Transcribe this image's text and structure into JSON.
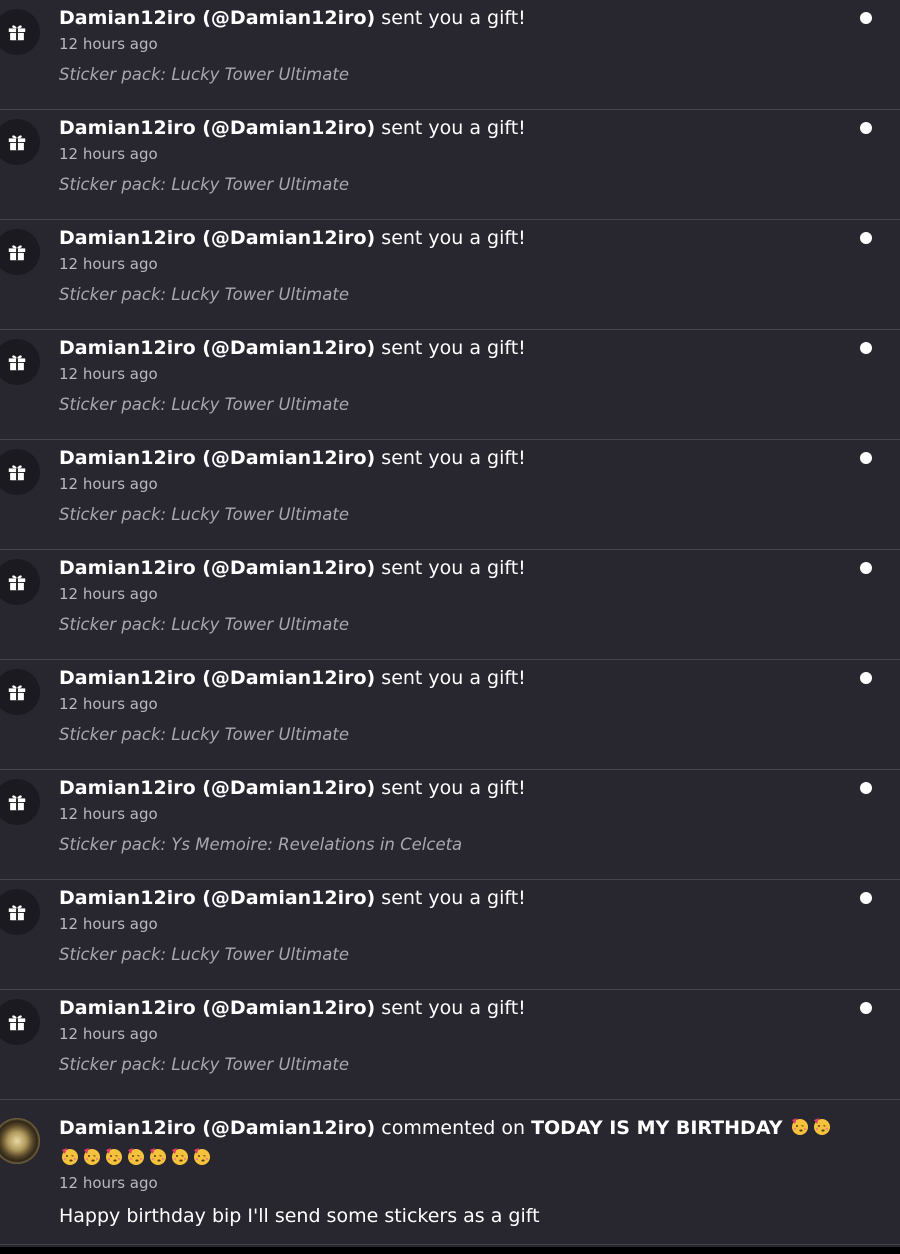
{
  "notifications": [
    {
      "user": "Damian12iro (@Damian12iro)",
      "action": " sent you a gift!",
      "time": "12 hours ago",
      "detail": "Sticker pack: Lucky Tower Ultimate",
      "unread": true
    },
    {
      "user": "Damian12iro (@Damian12iro)",
      "action": " sent you a gift!",
      "time": "12 hours ago",
      "detail": "Sticker pack: Lucky Tower Ultimate",
      "unread": true
    },
    {
      "user": "Damian12iro (@Damian12iro)",
      "action": " sent you a gift!",
      "time": "12 hours ago",
      "detail": "Sticker pack: Lucky Tower Ultimate",
      "unread": true
    },
    {
      "user": "Damian12iro (@Damian12iro)",
      "action": " sent you a gift!",
      "time": "12 hours ago",
      "detail": "Sticker pack: Lucky Tower Ultimate",
      "unread": true
    },
    {
      "user": "Damian12iro (@Damian12iro)",
      "action": " sent you a gift!",
      "time": "12 hours ago",
      "detail": "Sticker pack: Lucky Tower Ultimate",
      "unread": true
    },
    {
      "user": "Damian12iro (@Damian12iro)",
      "action": " sent you a gift!",
      "time": "12 hours ago",
      "detail": "Sticker pack: Lucky Tower Ultimate",
      "unread": true
    },
    {
      "user": "Damian12iro (@Damian12iro)",
      "action": " sent you a gift!",
      "time": "12 hours ago",
      "detail": "Sticker pack: Lucky Tower Ultimate",
      "unread": true
    },
    {
      "user": "Damian12iro (@Damian12iro)",
      "action": " sent you a gift!",
      "time": "12 hours ago",
      "detail": "Sticker pack: Ys Memoire: Revelations in Celceta",
      "unread": true
    },
    {
      "user": "Damian12iro (@Damian12iro)",
      "action": " sent you a gift!",
      "time": "12 hours ago",
      "detail": "Sticker pack: Lucky Tower Ultimate",
      "unread": true
    },
    {
      "user": "Damian12iro (@Damian12iro)",
      "action": " sent you a gift!",
      "time": "12 hours ago",
      "detail": "Sticker pack: Lucky Tower Ultimate",
      "unread": true
    }
  ],
  "comment": {
    "user": "Damian12iro (@Damian12iro)",
    "action": " commented on ",
    "post_title": "TODAY IS MY BIRTHDAY",
    "emoji_count": 9,
    "emoji_name": "partying-face-emoji",
    "time": "12 hours ago",
    "text": "Happy birthday bip I'll send some stickers as a gift"
  },
  "colors": {
    "background": "#28262f",
    "divider": "#45434c",
    "unread_dot": "#ffffff",
    "secondary_text": "#b9b7c0"
  },
  "icons": {
    "gift": "gift-icon",
    "unread": "unread-dot-icon"
  }
}
